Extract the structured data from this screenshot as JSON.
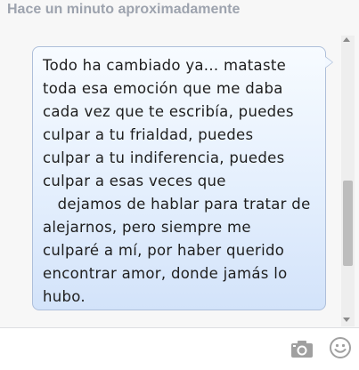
{
  "conversation": {
    "timestamp": "Hace un minuto aproximadamente",
    "messages": [
      {
        "text": "Todo ha cambiado ya... mataste\ntoda esa emoción que me daba\ncada vez que te escribía, puedes\nculpar a tu frialdad, puedes\nculpar a tu indiferencia, puedes\nculpar a esas veces que\n   dejamos de hablar para tratar de\nalejarnos, pero siempre me\nculparé a mí, por haber querido\nencontrar amor, donde jamás lo\nhubo.",
        "bubble_color": "#e4effd"
      }
    ]
  },
  "composer": {
    "input_value": "",
    "input_placeholder": ""
  },
  "icons": {
    "camera": "camera-icon",
    "smiley": "smiley-icon"
  },
  "colors": {
    "timestamp": "#9da3ae",
    "bubble_border": "#aebfda",
    "icon": "#a0a0a0"
  }
}
